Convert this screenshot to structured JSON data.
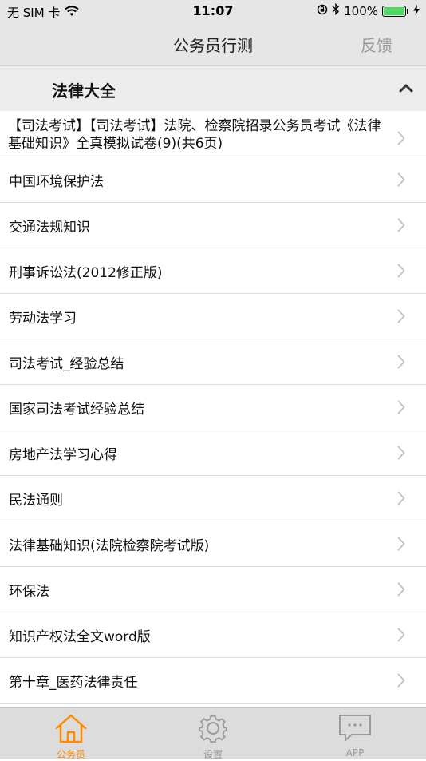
{
  "status_bar": {
    "carrier": "无 SIM 卡",
    "time": "11:07",
    "battery": "100%",
    "icons": [
      "wifi-icon",
      "rotation-lock-icon",
      "bluetooth-icon",
      "battery-icon",
      "charging-icon"
    ]
  },
  "nav": {
    "title": "公务员行测",
    "feedback_label": "反馈"
  },
  "section": {
    "title": "法律大全",
    "expanded": true
  },
  "list": {
    "items": [
      "【司法考试】【司法考试】法院、检察院招录公务员考试《法律基础知识》全真模拟试卷(9)(共6页)",
      "中国环境保护法",
      "交通法规知识",
      "刑事诉讼法(2012修正版)",
      "劳动法学习",
      "司法考试_经验总结",
      "国家司法考试经验总结",
      "房地产法学习心得",
      "民法通则",
      "法律基础知识(法院检察院考试版)",
      "环保法",
      "知识产权法全文word版",
      "第十章_医药法律责任"
    ]
  },
  "tab_bar": {
    "tabs": [
      {
        "label": "公务员",
        "icon": "home-icon",
        "active": true
      },
      {
        "label": "设置",
        "icon": "gear-icon",
        "active": false
      },
      {
        "label": "APP",
        "icon": "chat-bubble-icon",
        "active": false
      }
    ]
  },
  "colors": {
    "accent": "#ff8a00",
    "inactive": "#9a9a9a",
    "bar_bg": "#e6e6e6",
    "battery": "#4cd964"
  }
}
